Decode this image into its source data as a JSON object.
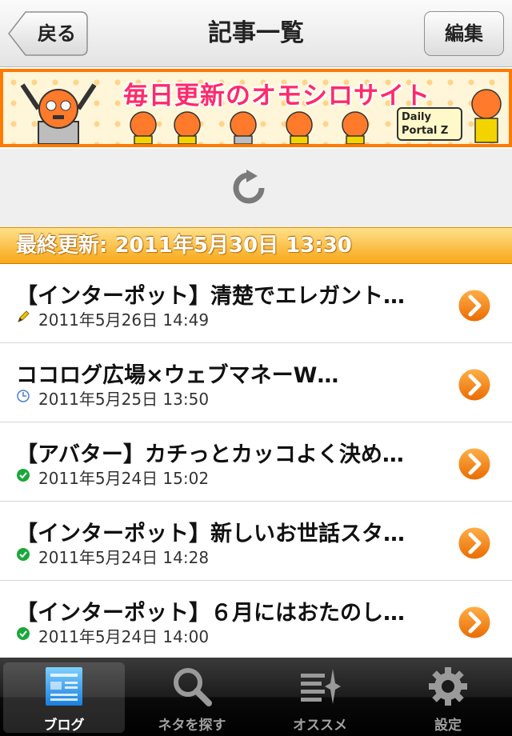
{
  "navbar": {
    "back_label": "戻る",
    "title": "記事一覧",
    "edit_label": "編集"
  },
  "banner": {
    "title": "毎日更新のオモシロサイト",
    "logo_line1": "Daily",
    "logo_line2": "Portal Z"
  },
  "last_updated": "最終更新: 2011年5月30日 13:30",
  "articles": [
    {
      "title": "【インターポット】清楚でエレガント…",
      "date": "2011年5月26日 14:49",
      "status_icon": "pencil-icon"
    },
    {
      "title": "ココログ広場×ウェブマネーW…",
      "date": "2011年5月25日 13:50",
      "status_icon": "clock-icon"
    },
    {
      "title": "【アバター】カチっとカッコよく決め…",
      "date": "2011年5月24日 15:02",
      "status_icon": "check-icon"
    },
    {
      "title": "【インターポット】新しいお世話スタ…",
      "date": "2011年5月24日 14:28",
      "status_icon": "check-icon"
    },
    {
      "title": "【インターポット】６月にはおたのし…",
      "date": "2011年5月24日 14:00",
      "status_icon": "check-icon"
    }
  ],
  "tabs": [
    {
      "label": "ブログ",
      "icon": "blog-icon",
      "selected": true
    },
    {
      "label": "ネタを探す",
      "icon": "search-icon",
      "selected": false
    },
    {
      "label": "オススメ",
      "icon": "recommend-icon",
      "selected": false
    },
    {
      "label": "設定",
      "icon": "gear-icon",
      "selected": false
    }
  ],
  "colors": {
    "accent_orange": "#f7a716",
    "arrow_orange": "#f07a00",
    "check_green": "#1aa83a",
    "banner_pink": "#ff2a6a"
  }
}
